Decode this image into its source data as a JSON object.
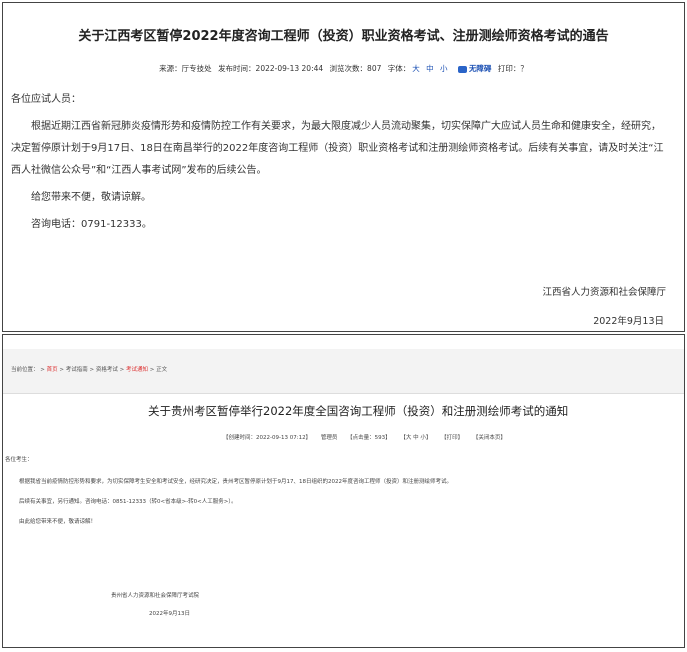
{
  "jiangxi": {
    "title": "关于江西考区暂停2022年度咨询工程师（投资）职业资格考试、注册测绘师资格考试的通告",
    "meta": {
      "source": "来源：厅专技处",
      "published": "发布时间：2022-09-13 20:44",
      "views_label": "浏览次数：",
      "views": "807",
      "font_label": "字体：",
      "font_sizes": [
        "大",
        "中",
        "小"
      ],
      "accessibility": "无障碍",
      "print": "打印：？"
    },
    "salutation": "各位应试人员：",
    "paragraph1": "根据近期江西省新冠肺炎疫情形势和疫情防控工作有关要求，为最大限度减少人员流动聚集，切实保障广大应试人员生命和健康安全，经研究，决定暂停原计划于9月17日、18日在南昌举行的2022年度咨询工程师（投资）职业资格考试和注册测绘师资格考试。后续有关事宜，请及时关注“江西人社微信公众号”和“江西人事考试网”发布的后续公告。",
    "apology": "给您带来不便，敬请谅解。",
    "phone": "咨询电话：0791-12333。",
    "signature": "江西省人力资源和社会保障厅",
    "date": "2022年9月13日"
  },
  "guizhou": {
    "breadcrumb": {
      "prefix": "当前位置：",
      "items": [
        "首页",
        "考试指南",
        "资格考试",
        "考试通知",
        "正文"
      ],
      "separator": ">"
    },
    "title": "关于贵州考区暂停举行2022年度全国咨询工程师（投资）和注册测绘师考试的通知",
    "meta": {
      "created": "【创建时间：2022-09-13 07:12】",
      "author": "管理员",
      "clicks": "【点击量：593】",
      "font": "【大 中 小】",
      "print": "【打印】",
      "close": "【关闭本页】"
    },
    "salutation": "各位考生：",
    "line1": "根据我省当前疫情防控形势和要求，为切实保障考生安全和考试安全，经研究决定，贵州考区暂停原计划于9月17、18日组织的2022年度咨询工程师（投资）和注册测绘师考试。",
    "line2": "后续有关事宜，另行通知。咨询电话：0851-12333（转0<省本级>-转0<人工服务>）。",
    "line3": "由此给您带来不便，敬请谅解！",
    "signature": "贵州省人力资源和社会保障厅考试院",
    "date": "2022年9月13日"
  }
}
